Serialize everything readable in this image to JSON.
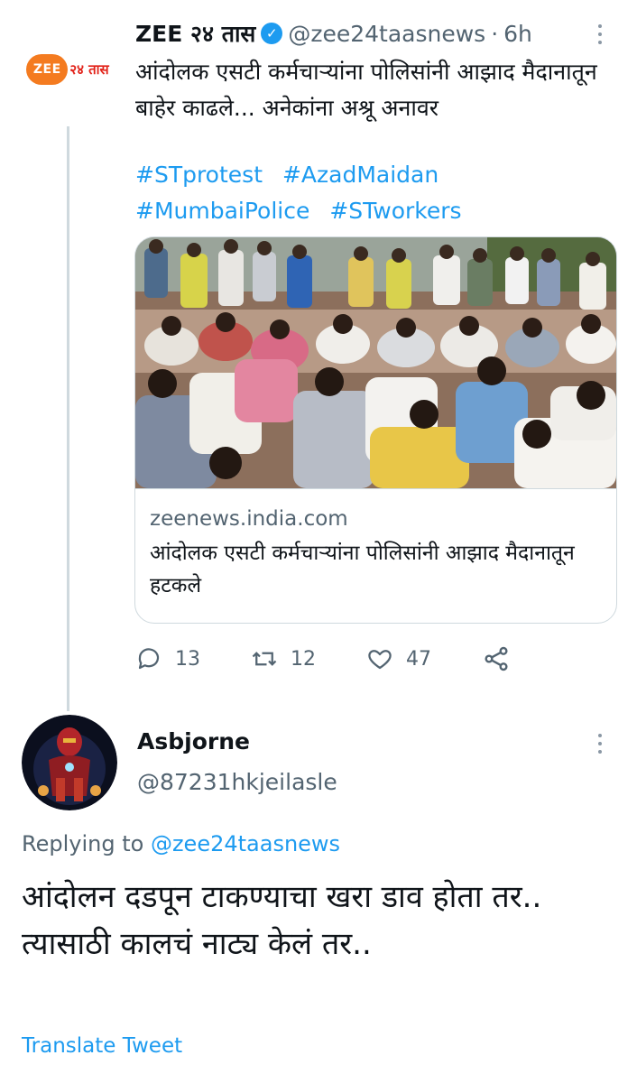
{
  "original_tweet": {
    "display_name": "ZEE २४ तास",
    "handle": "@zee24taasnews",
    "separator": "·",
    "time": "6h",
    "avatar_logo": {
      "mark": "ZEE",
      "sub": "२४ तास"
    },
    "text": "आंदोलक एसटी कर्मचाऱ्यांना पोलिसांनी आझाद मैदानातून बाहेर काढले... अनेकांना अश्रू अनावर",
    "hashtags": [
      "#STprotest",
      "#AzadMaidan",
      "#MumbaiPolice",
      "#STworkers"
    ],
    "card": {
      "domain": "zeenews.india.com",
      "title": "आंदोलक एसटी कर्मचाऱ्यांना पोलिसांनी आझाद मैदानातून हटकले"
    },
    "actions": {
      "replies": "13",
      "retweets": "12",
      "likes": "47"
    }
  },
  "reply_tweet": {
    "display_name": "Asbjorne",
    "handle": "@87231hkjeilasle",
    "replying_prefix": "Replying to",
    "replying_to": "@zee24taasnews",
    "line1": "आंदोलन दडपून टाकण्याचा खरा डाव होता तर..",
    "line2": "त्यासाठी कालचं नाट्य केलं तर..",
    "translate_label": "Translate Tweet"
  },
  "colors": {
    "accent": "#1d9bf0",
    "muted": "#536471",
    "zee_orange": "#f47b20",
    "zee_red": "#e2231a"
  }
}
